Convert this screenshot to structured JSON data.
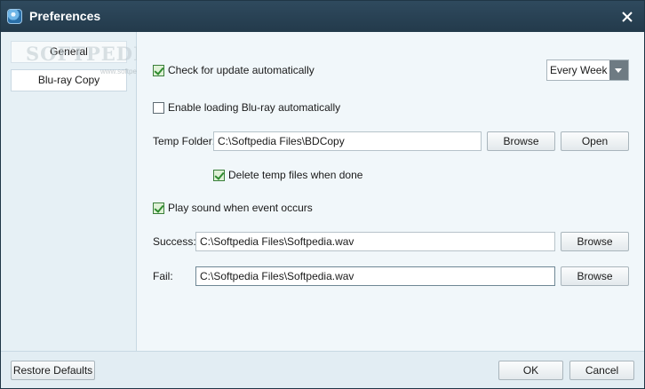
{
  "window": {
    "title": "Preferences"
  },
  "sidebar": {
    "watermark": "SOFTPEDIA",
    "watermark_small": "www.softpedia.com",
    "items": [
      {
        "label": "General",
        "selected": true
      },
      {
        "label": "Blu-ray Copy",
        "selected": false
      }
    ]
  },
  "general": {
    "check_update": {
      "label": "Check for update automatically",
      "checked": true
    },
    "update_frequency": {
      "value": "Every Week"
    },
    "enable_loading": {
      "label": "Enable loading Blu-ray automatically",
      "checked": false
    },
    "temp_folder": {
      "label": "Temp Folder:",
      "value": "C:\\Softpedia Files\\BDCopy",
      "browse_label": "Browse",
      "open_label": "Open"
    },
    "delete_temp": {
      "label": "Delete temp files when done",
      "checked": true
    },
    "play_sound": {
      "label": "Play sound when event occurs",
      "checked": true
    },
    "success": {
      "label": "Success:",
      "value": "C:\\Softpedia Files\\Softpedia.wav",
      "browse_label": "Browse"
    },
    "fail": {
      "label": "Fail:",
      "value": "C:\\Softpedia Files\\Softpedia.wav",
      "browse_label": "Browse"
    }
  },
  "footer": {
    "restore_label": "Restore Defaults",
    "ok_label": "OK",
    "cancel_label": "Cancel"
  },
  "colors": {
    "titlebar": "#2a4255",
    "panel_background": "#f1f7fa",
    "sidebar_background": "#e6f0f5",
    "checkbox_check": "#2e8b2e"
  }
}
